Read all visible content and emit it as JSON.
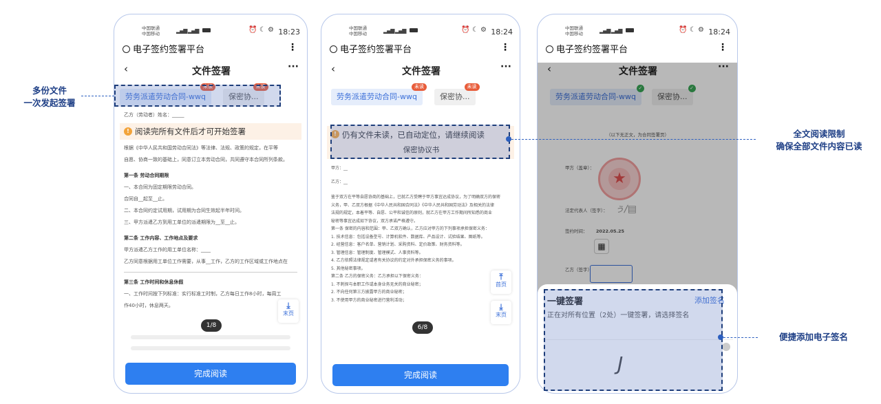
{
  "status_bar": {
    "carrier_top": "中国联通",
    "carrier_bottom": "中国移动",
    "phone1_time": "18:23",
    "phone2_time": "18:24",
    "phone3_time": "18:24"
  },
  "app_title": "电子签约签署平台",
  "page_title": "文件签署",
  "tabs": {
    "doc1": "劳务派遣劳动合同-wwq",
    "doc2": "保密协...",
    "unread_badge": "未读"
  },
  "phone1": {
    "notice": "阅读完所有文件后才可开始签署",
    "doc_lines": [
      "乙方（劳动者）姓名：_____",
      "根据《中华人民共和国劳动合同法》等法律、法规、政策的规定，在平等",
      "自愿、协商一致的基础上，同意订立本劳动合同，共同遵守本合同所列条款。",
      "第一条  劳动合同期限",
      "一、本合同为固定期限劳动合同。",
      "合同自__起至__止。",
      "二、本合同约定试用期，试用期为合同生效起半年时间。",
      "三、甲方派遣乙方到用工单位的派遣期限为__至__止。",
      "第二条  工作内容、工作地点及要求",
      "甲方派遣乙方工作的用工单位名称：____",
      "乙方同意根据用工单位工作需要，从事__工作，乙方的工作区域或工作地点在",
      "第三条  工作时间和休息休假",
      "一、工作时间按下列标准：实行标准工时制，乙方每日工作8小时，每周工",
      "作40小时，休息两天。"
    ],
    "pager": "1/8",
    "end_label": "末页",
    "button": "完成阅读"
  },
  "phone2": {
    "notice_line1": "仍有文件未读，已自动定位，请继续阅读",
    "notice_line2": "保密协议书",
    "doc_lines": [
      "甲方：__",
      "乙方：__",
      "鉴于双方在平等自愿协商的基础上，已就乙方受聘于甲方事宜达成协议，为了明确双方的保密",
      "义务，甲、乙双方根据《中华人民共和国合同法》《中华人民共和国劳动法》及相关的法律",
      "法规的规定，本着平等、自愿、公平和诚信的原则，就乙方在甲方工作期间所知悉的商业",
      "秘密等事宜达成如下协议，双方承诺严格遵守。",
      "第一条  保密的内容和范围：甲、乙双方确认，乙方应对甲方的下列事项承担保密义务：",
      "1. 技术信息：包括设备型号、计算机软件、数据库、产品设计、试验结果、图纸等。",
      "2. 经营信息：客户名单、营销计划、采购资料、定价政策、财务资料等。",
      "3. 管理信息：管理制度、管理模式、人事资料等。",
      "4. 乙方依照法律规定或者有关协议的约定对外承担保密义务的事项。",
      "5. 其他秘密事项。",
      "第二条  乙方的保密义务：乙方承担以下保密义务：",
      "1. 不刺探与本职工作或本身业务无关的商业秘密；",
      "2. 不向任何第三方披露甲方的商业秘密；",
      "3. 不使用甲方的商业秘密进行营利活动；"
    ],
    "pager": "6/8",
    "home_label": "首页",
    "end_label": "末页",
    "button": "完成阅读"
  },
  "phone3": {
    "doc_lines": [
      "（以下无正文，为合同签署页）",
      "甲方（盖章）：",
      "法定代表人（签字）：",
      "签约时间：",
      "乙方（签字）："
    ],
    "sign_date": "2022.05.25",
    "sheet_title": "一键签署",
    "sheet_add": "添加签名",
    "sheet_desc": "正在对所有位置（2处）一键签署，请选择签名"
  },
  "callouts": {
    "left_line1": "多份文件",
    "left_line2": "一次发起签署",
    "right_top_line1": "全文阅读限制",
    "right_top_line2": "确保全部文件内容已读",
    "right_bottom": "便捷添加电子签名"
  },
  "colors": {
    "accent": "#2e7ff0",
    "callout_text": "#1e3f86",
    "badge": "#e85c3a",
    "highlight": "#5a78be"
  }
}
